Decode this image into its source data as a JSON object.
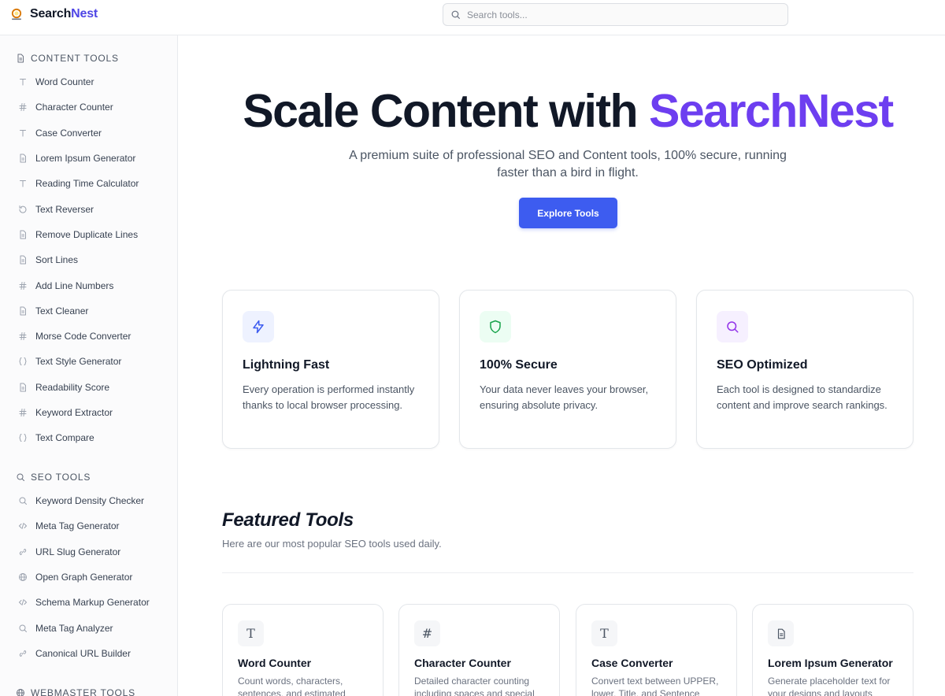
{
  "header": {
    "brand_part1": "Search",
    "brand_part2": "Nest",
    "search_placeholder": "Search tools..."
  },
  "sidebar": {
    "sections": [
      {
        "title": "CONTENT TOOLS",
        "icon": "document-icon",
        "items": [
          {
            "label": "Word Counter",
            "icon": "type-icon"
          },
          {
            "label": "Character Counter",
            "icon": "hash-icon"
          },
          {
            "label": "Case Converter",
            "icon": "type-icon"
          },
          {
            "label": "Lorem Ipsum Generator",
            "icon": "document-icon"
          },
          {
            "label": "Reading Time Calculator",
            "icon": "type-icon"
          },
          {
            "label": "Text Reverser",
            "icon": "rotate-icon"
          },
          {
            "label": "Remove Duplicate Lines",
            "icon": "document-icon"
          },
          {
            "label": "Sort Lines",
            "icon": "document-icon"
          },
          {
            "label": "Add Line Numbers",
            "icon": "hash-icon"
          },
          {
            "label": "Text Cleaner",
            "icon": "document-icon"
          },
          {
            "label": "Morse Code Converter",
            "icon": "hash-icon"
          },
          {
            "label": "Text Style Generator",
            "icon": "braces-icon"
          },
          {
            "label": "Readability Score",
            "icon": "document-icon"
          },
          {
            "label": "Keyword Extractor",
            "icon": "hash-icon"
          },
          {
            "label": "Text Compare",
            "icon": "braces-icon"
          }
        ]
      },
      {
        "title": "SEO TOOLS",
        "icon": "search-icon",
        "items": [
          {
            "label": "Keyword Density Checker",
            "icon": "search-icon"
          },
          {
            "label": "Meta Tag Generator",
            "icon": "code-icon"
          },
          {
            "label": "URL Slug Generator",
            "icon": "link-icon"
          },
          {
            "label": "Open Graph Generator",
            "icon": "globe-icon"
          },
          {
            "label": "Schema Markup Generator",
            "icon": "code-icon"
          },
          {
            "label": "Meta Tag Analyzer",
            "icon": "search-icon"
          },
          {
            "label": "Canonical URL Builder",
            "icon": "link-icon"
          }
        ]
      },
      {
        "title": "WEBMASTER TOOLS",
        "icon": "globe-icon",
        "items": []
      }
    ]
  },
  "hero": {
    "title_main": "Scale Content with ",
    "title_accent": "SearchNest",
    "subtitle": "A premium suite of professional SEO and Content tools, 100% secure, running faster than a bird in flight.",
    "cta_label": "Explore Tools"
  },
  "features": [
    {
      "title": "Lightning Fast",
      "desc": "Every operation is performed instantly thanks to local browser processing.",
      "icon": "lightning-icon",
      "color": "#3d5cf0",
      "bg": "#eef2ff"
    },
    {
      "title": "100% Secure",
      "desc": "Your data never leaves your browser, ensuring absolute privacy.",
      "icon": "shield-icon",
      "color": "#16a34a",
      "bg": "#ecfdf3"
    },
    {
      "title": "SEO Optimized",
      "desc": "Each tool is designed to standardize content and improve search rankings.",
      "icon": "search-icon",
      "color": "#9333ea",
      "bg": "#f6f0ff"
    }
  ],
  "featured": {
    "title": "Featured Tools",
    "subtitle": "Here are our most popular SEO tools used daily.",
    "tools": [
      {
        "title": "Word Counter",
        "desc": "Count words, characters, sentences, and estimated",
        "icon": "type-icon",
        "glyph": "T"
      },
      {
        "title": "Character Counter",
        "desc": "Detailed character counting including spaces and special",
        "icon": "hash-icon",
        "glyph": "#"
      },
      {
        "title": "Case Converter",
        "desc": "Convert text between UPPER, lower, Title, and Sentence",
        "icon": "type-icon",
        "glyph": "T"
      },
      {
        "title": "Lorem Ipsum Generator",
        "desc": "Generate placeholder text for your designs and layouts",
        "icon": "document-icon",
        "glyph": ""
      }
    ]
  },
  "colors": {
    "accent": "#6d3ef0",
    "brand_blue": "#3d5cf0"
  }
}
